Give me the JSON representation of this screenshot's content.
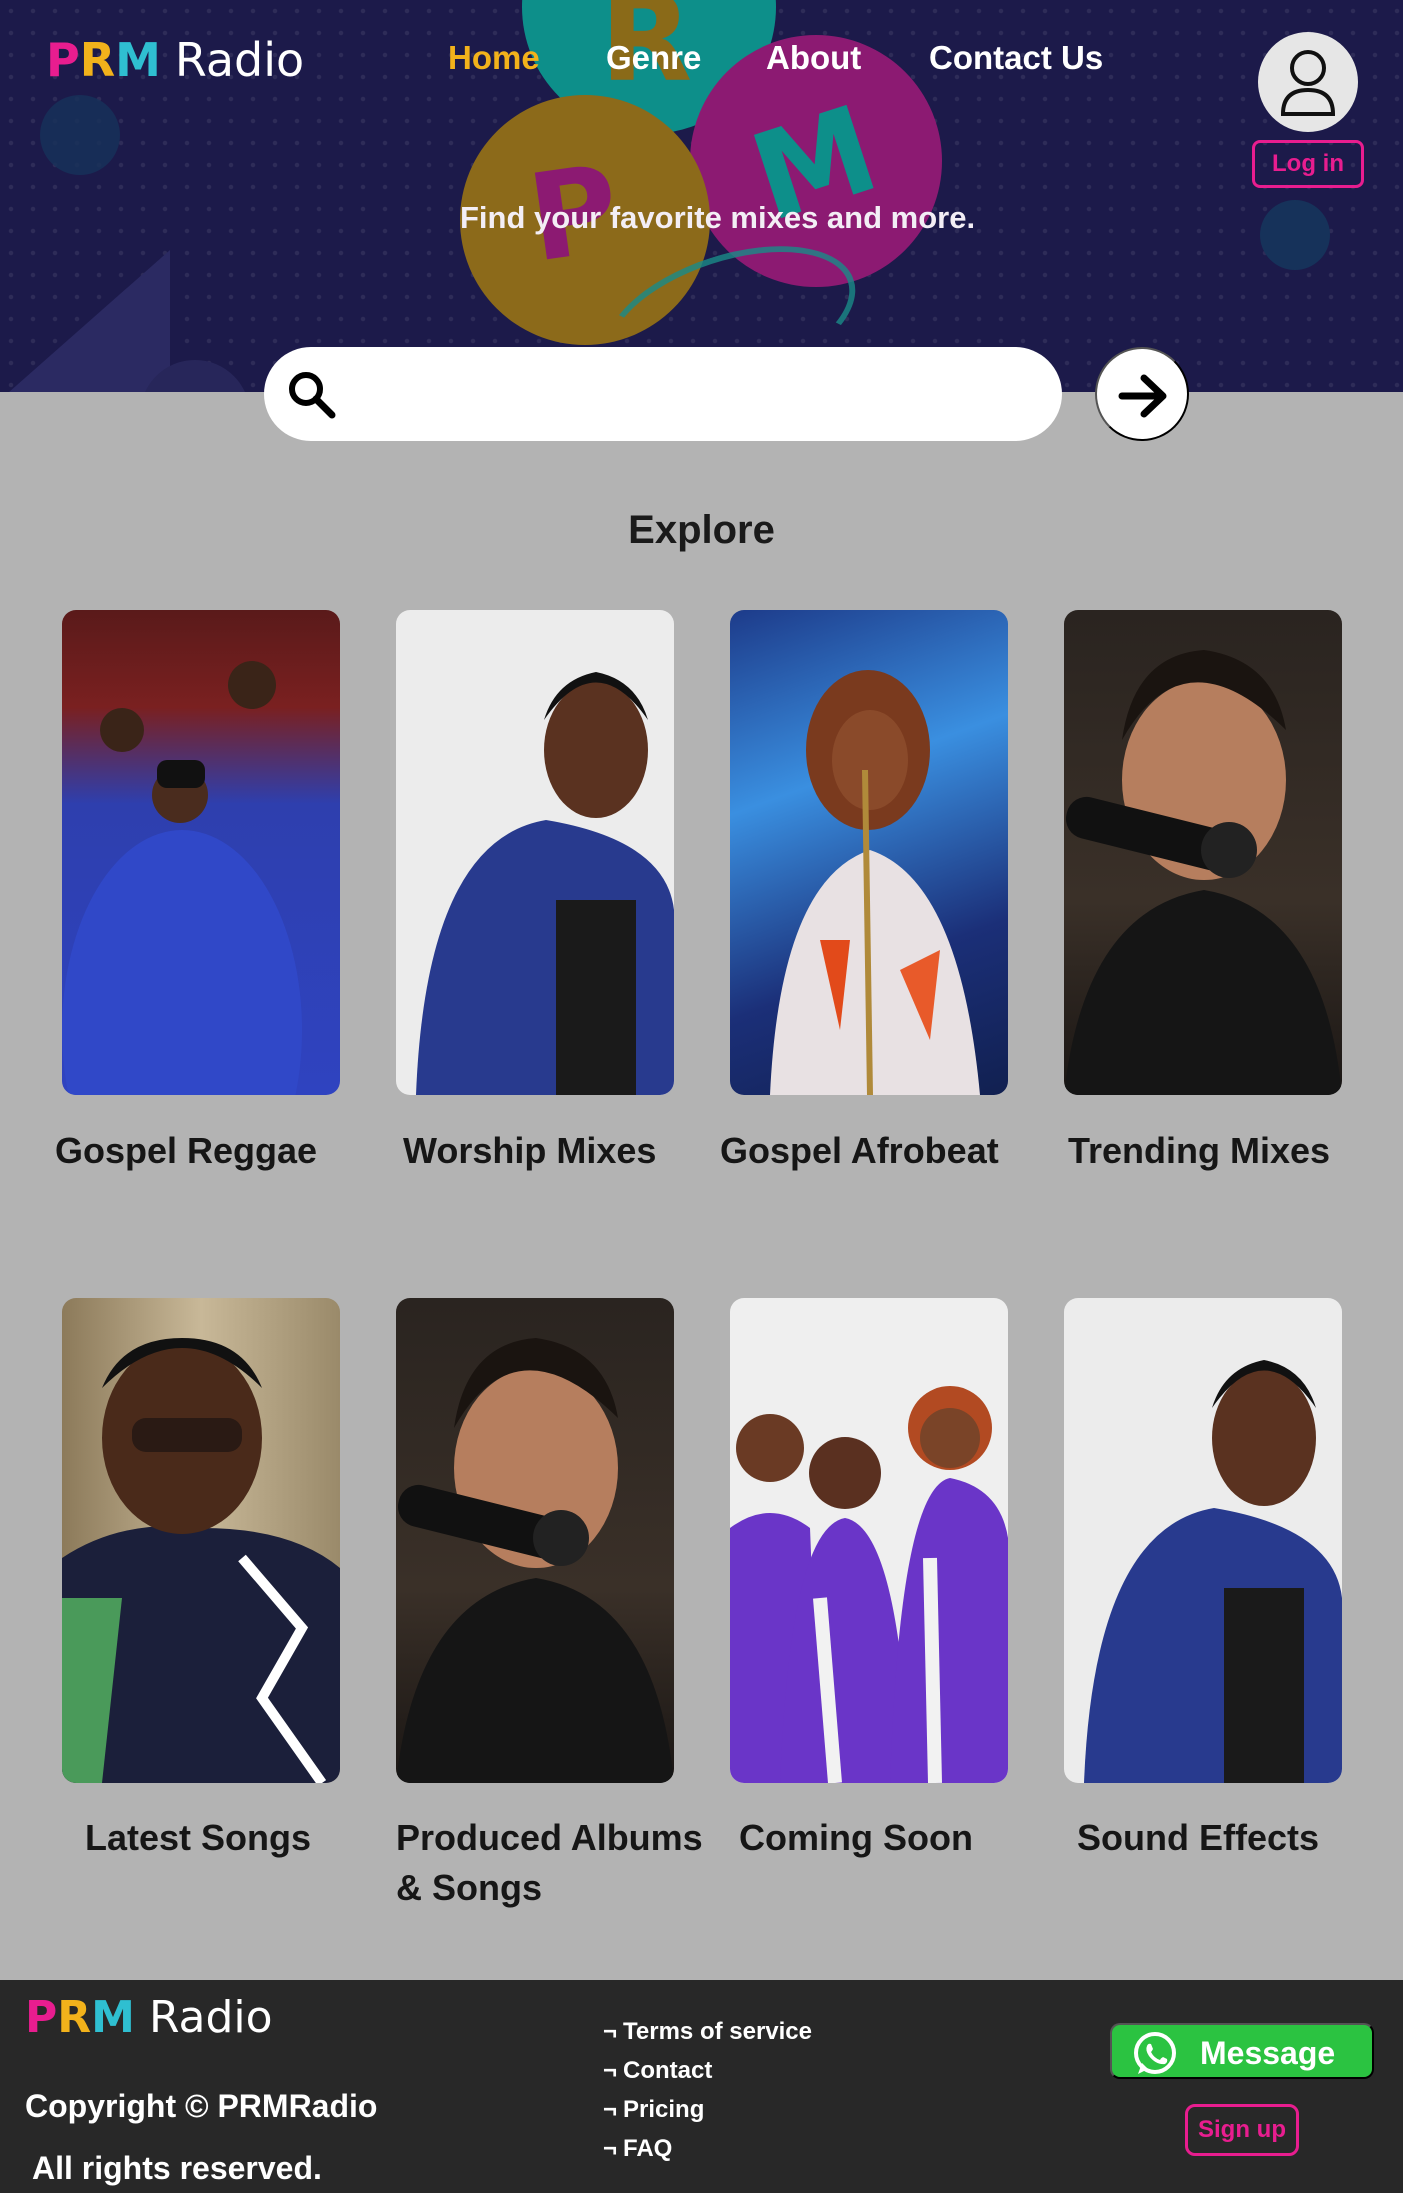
{
  "brand": {
    "logo_letters": [
      "P",
      "R",
      "M"
    ],
    "logo_word": "Radio",
    "colors": {
      "p": "#e81d8f",
      "r": "#f2b21b",
      "m": "#2fbfd1",
      "accent": "#e81d8f",
      "nav_active": "#f2b21b",
      "whatsapp": "#2bc341"
    }
  },
  "nav": {
    "items": [
      {
        "label": "Home",
        "active": true
      },
      {
        "label": "Genre",
        "active": false
      },
      {
        "label": "About",
        "active": false
      },
      {
        "label": "Contact Us",
        "active": false
      }
    ]
  },
  "hero": {
    "tagline": "Find your favorite mixes and more.",
    "bg_letters": [
      "R",
      "P",
      "M"
    ]
  },
  "account": {
    "avatar_icon": "user-icon",
    "login_label": "Log in"
  },
  "search": {
    "value": "",
    "placeholder": "",
    "search_icon": "search-icon",
    "submit_icon": "arrow-right-icon"
  },
  "explore": {
    "title": "Explore",
    "cards": [
      {
        "label": "Gospel Reggae"
      },
      {
        "label": "Worship Mixes"
      },
      {
        "label": "Gospel Afrobeat"
      },
      {
        "label": "Trending Mixes"
      },
      {
        "label": "Latest Songs"
      },
      {
        "label": "Produced Albums & Songs"
      },
      {
        "label": "Coming Soon"
      },
      {
        "label": "Sound Effects"
      }
    ]
  },
  "footer": {
    "copyright": "Copyright © PRMRadio",
    "rights": "All rights reserved.",
    "link_bullet": "¬",
    "links": [
      {
        "label": "Terms of service"
      },
      {
        "label": "Contact"
      },
      {
        "label": "Pricing"
      },
      {
        "label": "FAQ"
      }
    ],
    "message_label": "Message",
    "message_icon": "whatsapp-icon",
    "signup_label": "Sign up"
  }
}
